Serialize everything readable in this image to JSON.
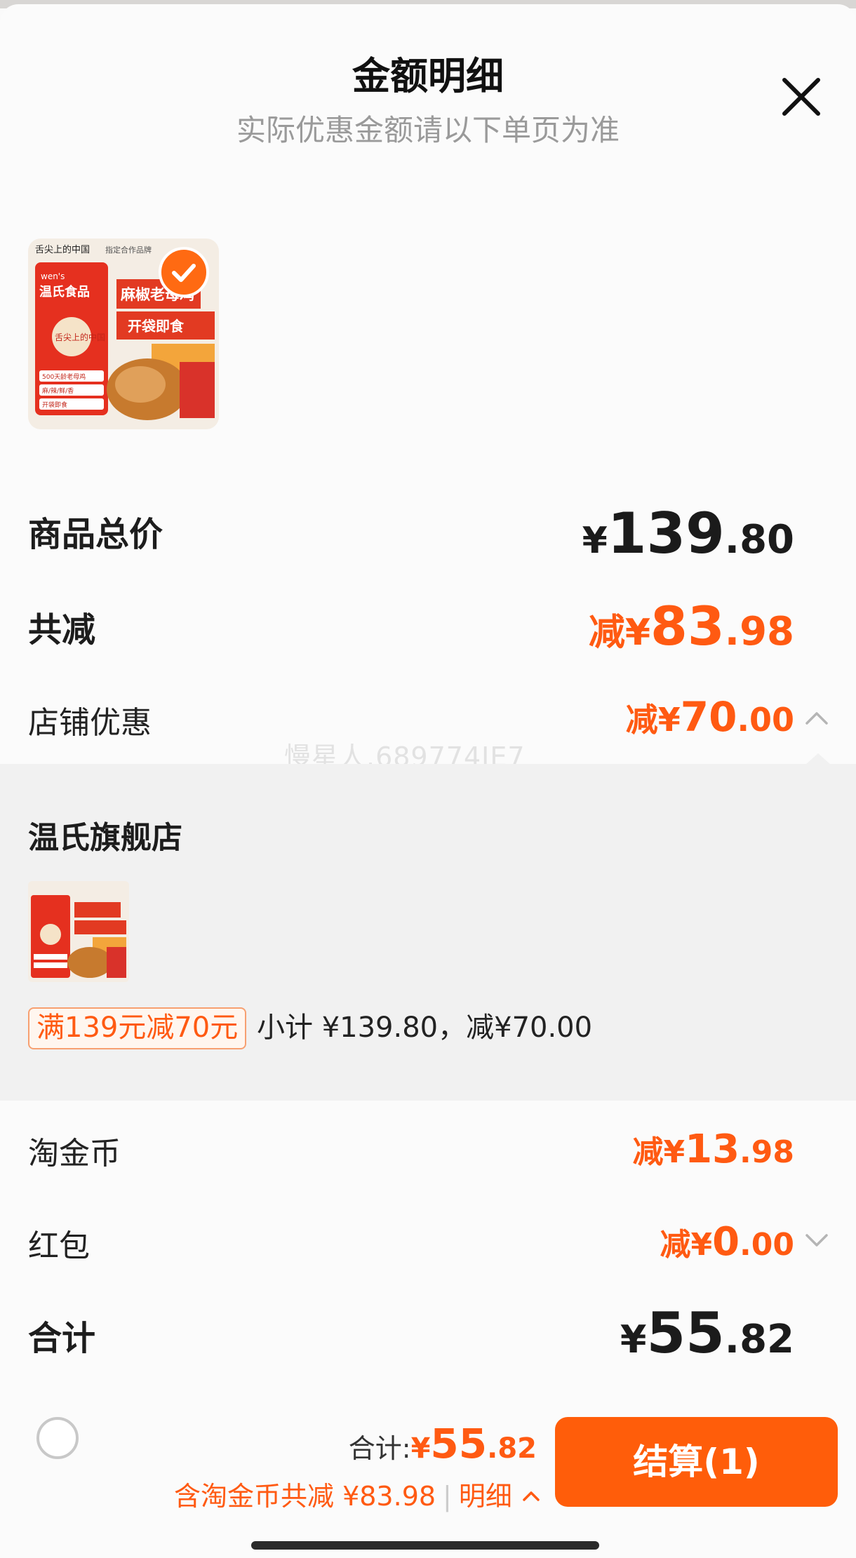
{
  "header": {
    "title": "金额明细",
    "subtitle": "实际优惠金额请以下单页为准"
  },
  "colors": {
    "accent": "#ff5a12",
    "button": "#ff5d0a"
  },
  "product": {
    "image_texts": [
      "舌尖上的中国",
      "指定合作品牌",
      "wen's",
      "温氏食品",
      "舌尖上的中国",
      "麻椒老母鸡",
      "开袋即食",
      "500天龄老母鸡",
      "麻/辣/鲜/香",
      "开袋即食"
    ]
  },
  "summary": {
    "total_label": "商品总价",
    "total_symbol": "¥",
    "total_int": "139",
    "total_dec": ".80",
    "discount_label": "共减",
    "discount_prefix": "减¥",
    "discount_int": "83",
    "discount_dec": ".98",
    "store_label": "店铺优惠",
    "store_prefix": "减¥",
    "store_int": "70",
    "store_dec": ".00"
  },
  "watermark": "慢星人.689774IE7",
  "store_detail": {
    "shop_name": "温氏旗舰店",
    "promo_tag": "满139元减70元",
    "subtotal_text": "小计 ¥139.80，减¥70.00"
  },
  "coins": {
    "label": "淘金币",
    "prefix": "减¥",
    "int": "13",
    "dec": ".98"
  },
  "redpacket": {
    "label": "红包",
    "prefix": "减¥",
    "int": "0",
    "dec": ".00"
  },
  "grand_total": {
    "label": "合计",
    "symbol": "¥",
    "int": "55",
    "dec": ".82"
  },
  "bottom_bar": {
    "sum_label": "合计:",
    "sum_symbol": "¥",
    "sum_int": "55",
    "sum_dec": ".82",
    "discount_text": "含淘金币共减 ¥83.98",
    "detail_link": "明细",
    "checkout_label": "结算(1)"
  },
  "icons": {
    "close": "close-icon",
    "selected": "check-icon",
    "store_toggle": "chevron-up-icon",
    "redpacket_toggle": "chevron-down-icon",
    "detail_toggle": "chevron-up-icon"
  }
}
